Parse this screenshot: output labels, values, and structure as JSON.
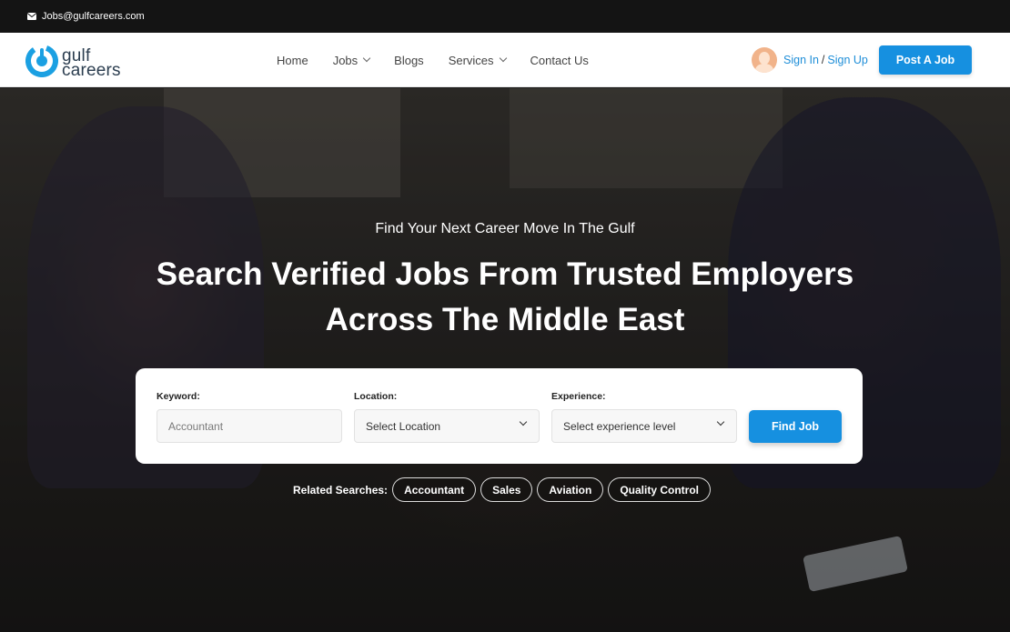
{
  "topbar": {
    "email": "Jobs@gulfcareers.com",
    "icon": "envelope-icon"
  },
  "logo": {
    "line1": "gulf",
    "line2": "careers",
    "accent": "#1ba0e2"
  },
  "nav": {
    "items": [
      {
        "label": "Home",
        "dropdown": false
      },
      {
        "label": "Jobs",
        "dropdown": true
      },
      {
        "label": "Blogs",
        "dropdown": false
      },
      {
        "label": "Services",
        "dropdown": true
      },
      {
        "label": "Contact Us",
        "dropdown": false
      }
    ],
    "sign_in": "Sign In",
    "separator": "/",
    "sign_up": "Sign Up",
    "post_job": "Post A Job"
  },
  "hero": {
    "subtitle": "Find Your Next Career Move In The Gulf",
    "title_line1": "Search Verified Jobs From Trusted Employers",
    "title_line2": "Across The Middle East"
  },
  "search": {
    "keyword": {
      "label": "Keyword:",
      "placeholder": "Accountant"
    },
    "location": {
      "label": "Location:",
      "value": "Select Location"
    },
    "experience": {
      "label": "Experience:",
      "value": "Select experience level"
    },
    "button": "Find Job"
  },
  "related": {
    "label": "Related Searches:",
    "chips": [
      "Accountant",
      "Sales",
      "Aviation",
      "Quality Control"
    ]
  },
  "colors": {
    "primary": "#1690e0",
    "link": "#1f8ed8"
  }
}
